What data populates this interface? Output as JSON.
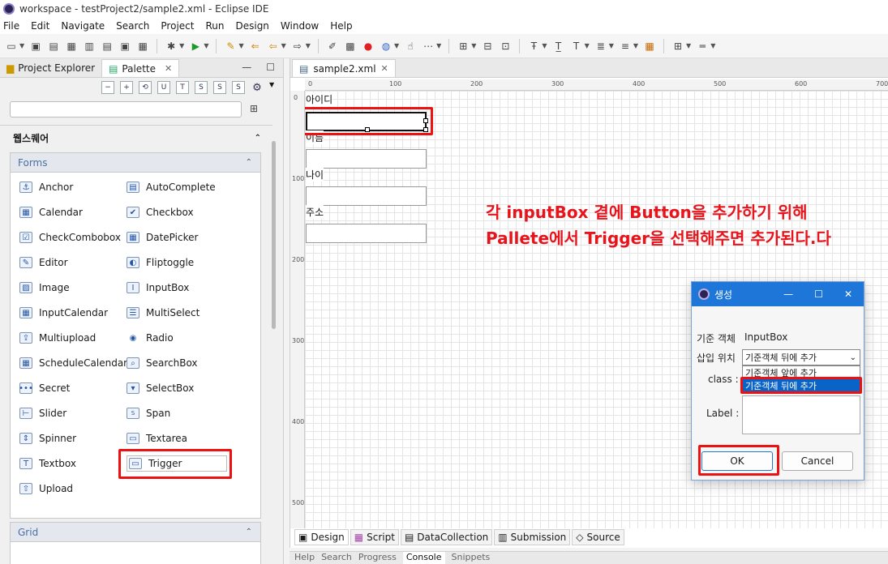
{
  "window": {
    "title": "workspace - testProject2/sample2.xml - Eclipse IDE"
  },
  "menu": [
    "File",
    "Edit",
    "Navigate",
    "Search",
    "Project",
    "Run",
    "Design",
    "Window",
    "Help"
  ],
  "left_panel": {
    "tabs": [
      {
        "label": "Project Explorer"
      },
      {
        "label": "Palette",
        "active": true
      }
    ],
    "group_title": "웹스퀘어",
    "forms_drawer": {
      "title": "Forms",
      "items_left": [
        "Anchor",
        "Calendar",
        "CheckCombobox",
        "Editor",
        "Image",
        "InputCalendar",
        "Multiupload",
        "ScheduleCalendar",
        "Secret",
        "Slider",
        "Spinner",
        "Textbox",
        "Upload"
      ],
      "items_right": [
        "AutoComplete",
        "Checkbox",
        "DatePicker",
        "Fliptoggle",
        "InputBox",
        "MultiSelect",
        "Radio",
        "SearchBox",
        "SelectBox",
        "Span",
        "Textarea",
        "Trigger"
      ]
    },
    "grid_drawer": {
      "title": "Grid"
    }
  },
  "editor": {
    "tab_label": "sample2.xml",
    "ruler_top": [
      "0",
      "100",
      "200",
      "300",
      "400",
      "500",
      "600",
      "700"
    ],
    "ruler_left": [
      "0",
      "100",
      "200",
      "300",
      "400",
      "500"
    ],
    "form_labels": [
      "아이디",
      "이름",
      "나이",
      "주소"
    ],
    "annotation_line1": "각 inputBox 곁에 Button을 추가하기 위해",
    "annotation_line2": "Pallete에서 Trigger을 선택해주면 추가된다.다",
    "bottom_tabs": [
      "Design",
      "Script",
      "DataCollection",
      "Submission",
      "Source"
    ]
  },
  "lower_tabs": [
    "Help",
    "Search",
    "Progress",
    "Console",
    "Snippets"
  ],
  "dialog": {
    "title": "생성",
    "ref_label": "기준 객체",
    "ref_value": "InputBox",
    "insert_label": "삽입 위치",
    "insert_selected": "기준객체 뒤에 추가",
    "options": [
      "기준객체 앞에 추가",
      "기준객체 뒤에 추가"
    ],
    "class_label": "class :",
    "label_label": "Label :",
    "ok": "OK",
    "cancel": "Cancel"
  }
}
